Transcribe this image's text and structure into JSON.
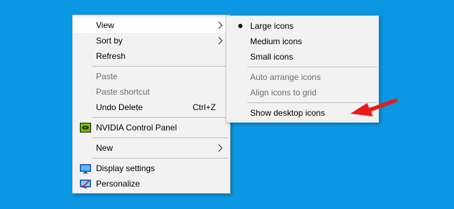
{
  "context_menu": {
    "items": [
      {
        "label": "View"
      },
      {
        "label": "Sort by"
      },
      {
        "label": "Refresh"
      },
      {
        "label": "Paste"
      },
      {
        "label": "Paste shortcut"
      },
      {
        "label": "Undo Delete",
        "shortcut": "Ctrl+Z"
      },
      {
        "label": "NVIDIA Control Panel"
      },
      {
        "label": "New"
      },
      {
        "label": "Display settings"
      },
      {
        "label": "Personalize"
      }
    ]
  },
  "view_submenu": {
    "items": [
      {
        "label": "Large icons",
        "selected": true
      },
      {
        "label": "Medium icons"
      },
      {
        "label": "Small icons"
      },
      {
        "label": "Auto arrange icons",
        "disabled": true
      },
      {
        "label": "Align icons to grid",
        "disabled": true
      },
      {
        "label": "Show desktop icons",
        "checked": false
      }
    ]
  },
  "colors": {
    "desktop_background": "#0b97e2",
    "menu_background": "#f2f2f2",
    "disabled_text": "#6d6d6d",
    "annotation_arrow": "#e81a1a",
    "nvidia_green": "#76b900"
  },
  "icons": {
    "nvidia": "nvidia-logo-icon",
    "display": "monitor-icon",
    "personalize": "personalize-icon",
    "submenu": "chevron-right-icon",
    "selected": "bullet-icon"
  }
}
